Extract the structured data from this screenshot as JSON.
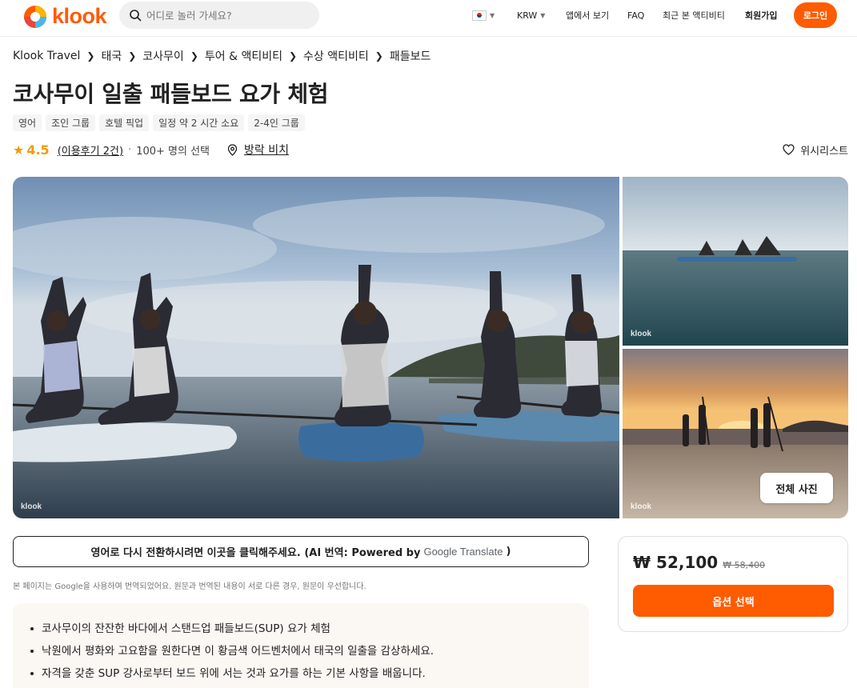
{
  "header": {
    "logo_text": "klook",
    "search_placeholder": "어디로 놀러 가세요?",
    "currency": "KRW",
    "nav_app": "앱에서 보기",
    "nav_faq": "FAQ",
    "nav_recent": "최근 본 액티비티",
    "nav_signup": "회원가입",
    "login_label": "로그인",
    "brand_color": "#ff5b00"
  },
  "breadcrumb": [
    "Klook Travel",
    "태국",
    "코사무이",
    "투어 & 액티비티",
    "수상 액티비티",
    "패들보드"
  ],
  "title": "코사무이 일출 패들보드 요가 체험",
  "tags": [
    "영어",
    "조인 그룹",
    "호텔 픽업",
    "일정 약 2 시간 소요",
    "2-4인 그룹"
  ],
  "rating": {
    "score": "4.5",
    "reviews": "(이용후기 2건)",
    "separator": "·",
    "booked": "100+ 명의 선택",
    "location": "방락 비치",
    "wishlist": "위시리스트"
  },
  "gallery": {
    "watermark": "klook",
    "all_photos": "전체 사진"
  },
  "translate": {
    "text": "영어로 다시 전환하시려면 이곳을 클릭해주세요. (AI 번역: Powered by",
    "google": "Google",
    "translate_word": "Translate",
    "close_paren": ")",
    "disclaimer": "본 페이지는 Google을 사용하여 번역되었어요. 원문과 번역된 내용이 서로 다른 경우, 원문이 우선합니다."
  },
  "highlights": [
    "코사무이의 잔잔한 바다에서 스탠드업 패들보드(SUP) 요가 체험",
    "낙원에서 평화와 고요함을 원한다면 이 황금색 어드벤처에서 태국의 일출을 감상하세요.",
    "자격을 갖춘 SUP 강사로부터 보드 위에 서는 것과 요가를 하는 기본 사항을 배웁니다."
  ],
  "price": {
    "current": "₩ 52,100",
    "original": "₩ 58,400",
    "select_label": "옵션 선택"
  }
}
